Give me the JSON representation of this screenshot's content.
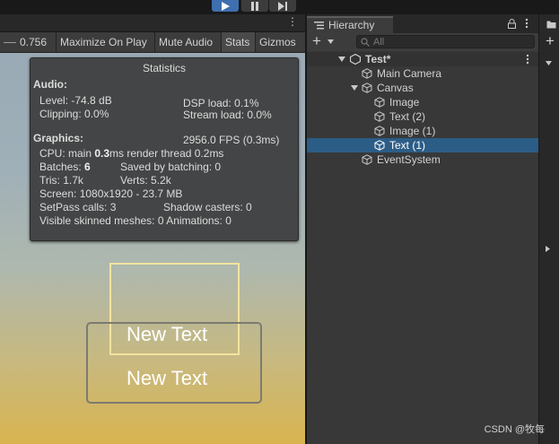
{
  "toolbar": {
    "play": "play-icon",
    "pause": "pause-icon",
    "step": "step-icon"
  },
  "game_view": {
    "more_menu": "⋮",
    "toolbar": {
      "scale": "0.756",
      "maximize_on_play": "Maximize On Play",
      "mute_audio": "Mute Audio",
      "stats": "Stats",
      "gizmos": "Gizmos"
    },
    "statistics": {
      "title": "Statistics",
      "audio_header": "Audio:",
      "level": "Level: -74.8 dB",
      "clipping": "Clipping: 0.0%",
      "dsp_load": "DSP load: 0.1%",
      "stream_load": "Stream load: 0.0%",
      "graphics_header": "Graphics:",
      "fps": "2956.0 FPS (0.3ms)",
      "cpu_prefix": "CPU: main ",
      "cpu_main": "0.3",
      "cpu_suffix": "ms  render thread 0.2ms",
      "batches_prefix": "Batches: ",
      "batches": "6",
      "saved_by_batching": "Saved by batching: 0",
      "tris": "Tris: 1.7k",
      "verts": "Verts: 5.2k",
      "screen": "Screen: 1080x1920 - 23.7 MB",
      "setpass": "SetPass calls: 3",
      "shadow_casters": "Shadow casters: 0",
      "skinned_meshes": "Visible skinned meshes: 0  Animations: 0"
    },
    "canvas_texts": [
      "New Text",
      "New Text"
    ]
  },
  "hierarchy": {
    "tab_label": "Hierarchy",
    "add_button": "+",
    "search_placeholder": "All",
    "scene_name": "Test*",
    "items": [
      {
        "label": "Main Camera"
      },
      {
        "label": "Canvas"
      },
      {
        "label": "Image"
      },
      {
        "label": "Text (2)"
      },
      {
        "label": "Image (1)"
      },
      {
        "label": "Text (1)",
        "selected": true
      },
      {
        "label": "EventSystem"
      }
    ]
  },
  "watermark": "CSDN @牧每",
  "colors": {
    "accent_play": "#3f6fae",
    "selection": "#2c5d87",
    "panel": "#383838",
    "stats_bg": "#444546"
  }
}
